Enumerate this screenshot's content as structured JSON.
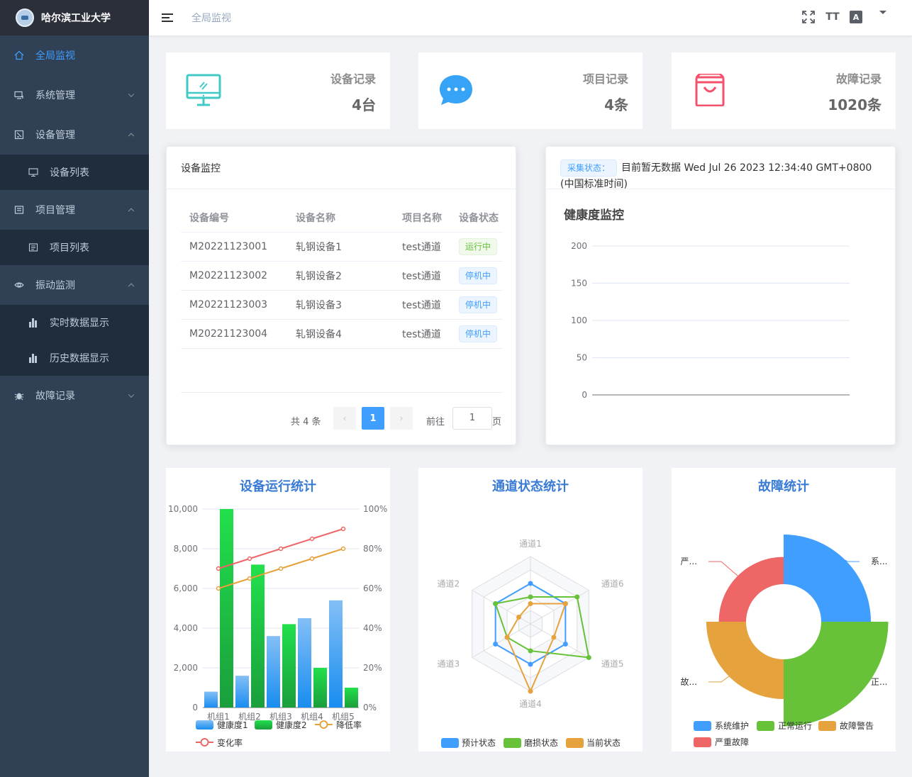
{
  "app": {
    "title": "哈尔滨工业大学"
  },
  "sidebar": {
    "items": [
      {
        "label": "全局监视"
      },
      {
        "label": "系统管理"
      },
      {
        "label": "设备管理"
      },
      {
        "label": "设备列表"
      },
      {
        "label": "项目管理"
      },
      {
        "label": "项目列表"
      },
      {
        "label": "振动监测"
      },
      {
        "label": "实时数据显示"
      },
      {
        "label": "历史数据显示"
      },
      {
        "label": "故障记录"
      }
    ]
  },
  "navbar": {
    "breadcrumb": "全局监视",
    "font_icon": "TT",
    "lang_icon": "A"
  },
  "stats": [
    {
      "label": "设备记录",
      "value": "4台",
      "icon": "monitor-icon",
      "color": "#40c9c6"
    },
    {
      "label": "项目记录",
      "value": "4条",
      "icon": "message-icon",
      "color": "#36a3f7"
    },
    {
      "label": "故障记录",
      "value": "1020条",
      "icon": "shopping-bag-icon",
      "color": "#f4516c"
    }
  ],
  "device_monitor": {
    "title": "设备监控",
    "columns": [
      "设备编号",
      "设备名称",
      "项目名称",
      "设备状态"
    ],
    "rows": [
      {
        "id": "M20221123001",
        "name": "轧钢设备1",
        "project": "test通道",
        "status": "运行中",
        "status_type": "success"
      },
      {
        "id": "M20221123002",
        "name": "轧钢设备2",
        "project": "test通道",
        "status": "停机中",
        "status_type": "info"
      },
      {
        "id": "M20221123003",
        "name": "轧钢设备3",
        "project": "test通道",
        "status": "停机中",
        "status_type": "info"
      },
      {
        "id": "M20221123004",
        "name": "轧钢设备4",
        "project": "test通道",
        "status": "停机中",
        "status_type": "info"
      }
    ],
    "pagination": {
      "total": "共 4 条",
      "current": "1",
      "goto": "前往",
      "jump_value": "1",
      "page_suffix": "页",
      "prev": "‹",
      "next": "›"
    }
  },
  "health": {
    "status_badge": "采集状态：",
    "status_text": "目前暂无数据 Wed Jul 26 2023 12:34:40 GMT+0800 (中国标准时间)"
  },
  "chart_data": [
    {
      "type": "line",
      "title": "健康度监控",
      "series": [],
      "ylim": [
        0,
        200
      ],
      "yticks": [
        "200",
        "150",
        "100",
        "50",
        "0"
      ]
    },
    {
      "type": "bar",
      "title": "设备运行统计",
      "categories": [
        "机组1",
        "机组2",
        "机组3",
        "机组4",
        "机组5"
      ],
      "series": [
        {
          "name": "健康度1",
          "type": "bar",
          "values": [
            800,
            1600,
            3600,
            4500,
            5400
          ],
          "color": "#409eff"
        },
        {
          "name": "健康度2",
          "type": "bar",
          "values": [
            10000,
            7200,
            4200,
            2000,
            1000
          ],
          "color": "#19d249"
        },
        {
          "name": "降低率",
          "type": "line",
          "axis": "right",
          "values": [
            60,
            65,
            70,
            75,
            80
          ],
          "color": "#e6a23c"
        },
        {
          "name": "变化率",
          "type": "line",
          "axis": "right",
          "values": [
            70,
            75,
            80,
            85,
            90
          ],
          "color": "#ee6666"
        }
      ],
      "ylim": [
        0,
        10000
      ],
      "yticks": [
        "10,000",
        "8,000",
        "6,000",
        "4,000",
        "2,000",
        "0"
      ],
      "y2lim": [
        0,
        100
      ],
      "y2ticks": [
        "100%",
        "80%",
        "60%",
        "40%",
        "20%",
        "0%"
      ]
    },
    {
      "type": "radar",
      "title": "通道状态统计",
      "indicators": [
        "通道1",
        "通道6",
        "通道5",
        "通道4",
        "通道3",
        "通道2"
      ],
      "max": 100,
      "series": [
        {
          "name": "预计状态",
          "values": [
            60,
            60,
            60,
            60,
            60,
            60
          ],
          "color": "#409eff"
        },
        {
          "name": "磨损状态",
          "values": [
            40,
            80,
            100,
            40,
            40,
            60
          ],
          "color": "#67c23a"
        },
        {
          "name": "当前状态",
          "values": [
            30,
            60,
            40,
            100,
            40,
            20
          ],
          "color": "#e6a23c"
        }
      ]
    },
    {
      "type": "pie",
      "title": "故障统计",
      "slices": [
        {
          "name": "系统维护",
          "short": "系...",
          "value": 25,
          "radius": 1.0,
          "color": "#409eff"
        },
        {
          "name": "正常运行",
          "short": "正...",
          "value": 25,
          "radius": 1.35,
          "color": "#67c23a"
        },
        {
          "name": "故障警告",
          "short": "故...",
          "value": 25,
          "radius": 0.8,
          "color": "#e6a23c"
        },
        {
          "name": "严重故障",
          "short": "严...",
          "value": 25,
          "radius": 0.55,
          "color": "#ee6666"
        }
      ]
    }
  ]
}
